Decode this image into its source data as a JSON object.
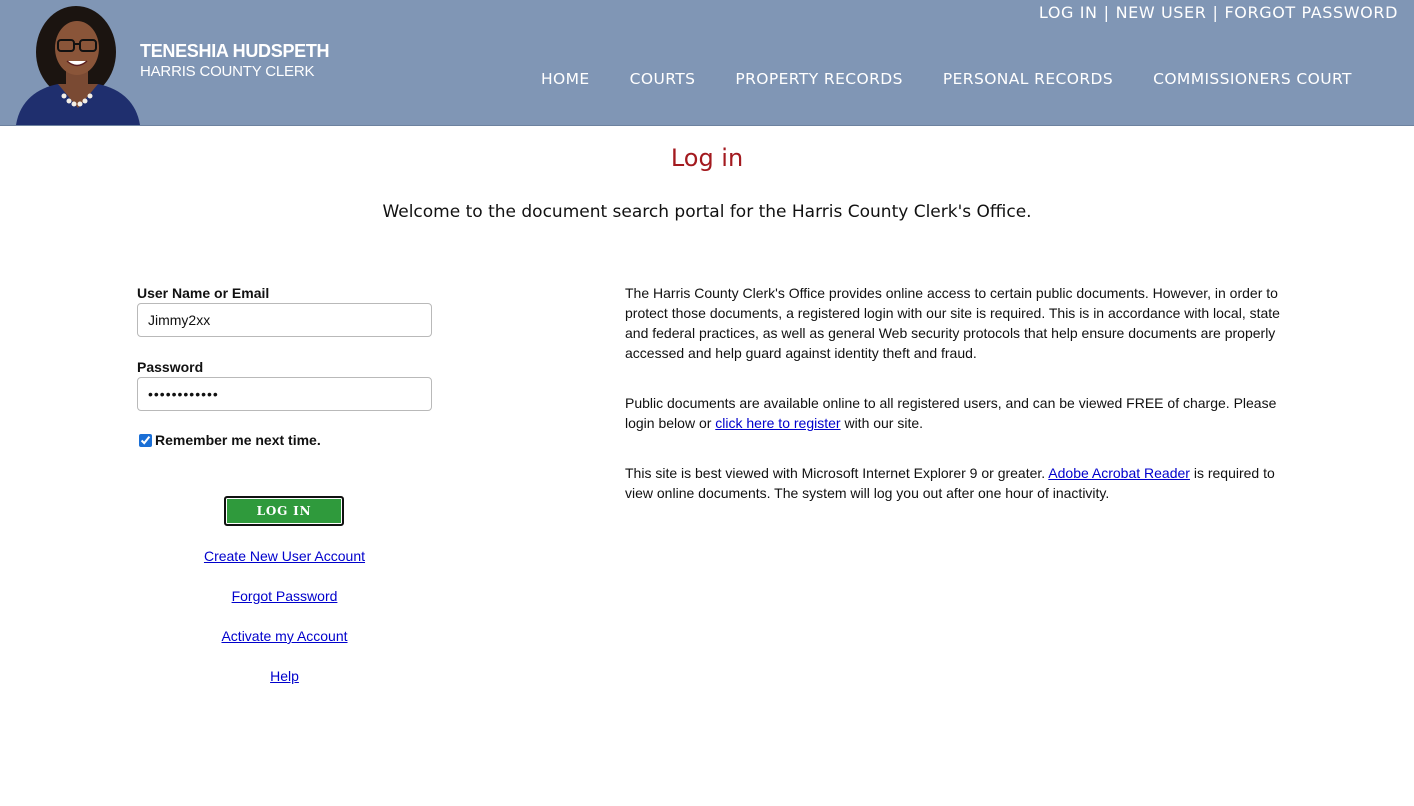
{
  "header": {
    "clerk_name": "TENESHIA HUDSPETH",
    "clerk_title": "HARRIS COUNTY CLERK",
    "util_links": [
      "LOG IN",
      "NEW USER",
      "FORGOT PASSWORD"
    ],
    "util_separator": "|",
    "nav": [
      "HOME",
      "COURTS",
      "PROPERTY RECORDS",
      "PERSONAL RECORDS",
      "COMMISSIONERS COURT"
    ],
    "background_color": "#8096b5"
  },
  "page": {
    "title": "Log in",
    "title_color": "#a31a1f",
    "welcome": "Welcome to the document search portal for the Harris County Clerk's Office."
  },
  "form": {
    "username_label": "User Name or Email",
    "username_value": "Jimmy2xx",
    "password_label": "Password",
    "password_value": "••••••••••••",
    "remember_label": "Remember me next time.",
    "remember_checked": true,
    "login_button": "LOG IN",
    "login_button_color": "#2f9a3c",
    "links": [
      "Create New User Account",
      "Forgot Password",
      "Activate my Account",
      "Help"
    ]
  },
  "info": {
    "p1": "The Harris County Clerk's Office provides online access to certain public documents. However, in order to protect those documents, a registered login with our site is required. This is in accordance with local, state and federal practices, as well as general Web security protocols that help ensure documents are properly accessed and help guard against identity theft and fraud.",
    "p2_before": "Public documents are available online to all registered users, and can be viewed FREE of charge. Please login below or ",
    "p2_link": "click here to register",
    "p2_after": " with our site.",
    "p3_before": "This site is best viewed with Microsoft Internet Explorer 9 or greater. ",
    "p3_link": "Adobe Acrobat Reader",
    "p3_after": " is required to view online documents. The system will log you out after one hour of inactivity."
  }
}
